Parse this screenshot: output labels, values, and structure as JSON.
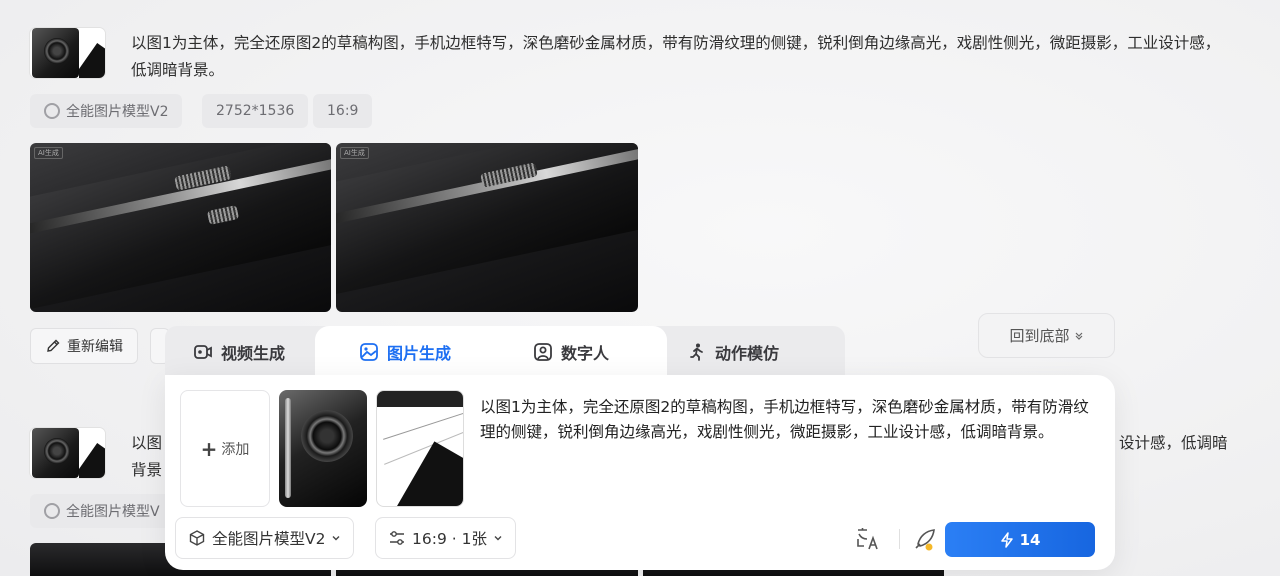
{
  "item1": {
    "prompt": "以图1为主体，完全还原图2的草稿构图，手机边框特写，深色磨砂金属材质，带有防滑纹理的侧键，锐利倒角边缘高光，戏剧性侧光，微距摄影，工业设计感，低调暗背景。",
    "tags": {
      "model": "全能图片模型V2",
      "size": "2752*1536",
      "ratio": "16:9"
    },
    "image_badge": "AI生成",
    "actions": {
      "re_edit": "重新编辑"
    }
  },
  "item2": {
    "prompt_head": "以图",
    "prompt_head2": "背景",
    "prompt_tail": "设计感，低调暗",
    "model_tag": "全能图片模型V"
  },
  "back_to_bottom": "回到底部",
  "tabs": [
    "视频生成",
    "图片生成",
    "数字人",
    "动作模仿"
  ],
  "active_tab": "图片生成",
  "panel": {
    "add_label": "添加",
    "prompt": "以图1为主体，完全还原图2的草稿构图，手机边框特写，深色磨砂金属材质，带有防滑纹理的侧键，锐利倒角边缘高光，戏剧性侧光，微距摄影，工业设计感，低调暗背景。",
    "model": "全能图片模型V2",
    "settings": "16:9 · 1张",
    "generate_cost": "14"
  },
  "colors": {
    "accent": "#1d6ff2",
    "button": "#2b7ff5"
  },
  "icons": [
    "cube-icon",
    "sliders-icon",
    "translate-icon",
    "rocket-icon",
    "bolt-icon",
    "pencil-icon",
    "video-icon",
    "image-icon",
    "person-icon",
    "run-icon",
    "chevron-down-icon"
  ]
}
